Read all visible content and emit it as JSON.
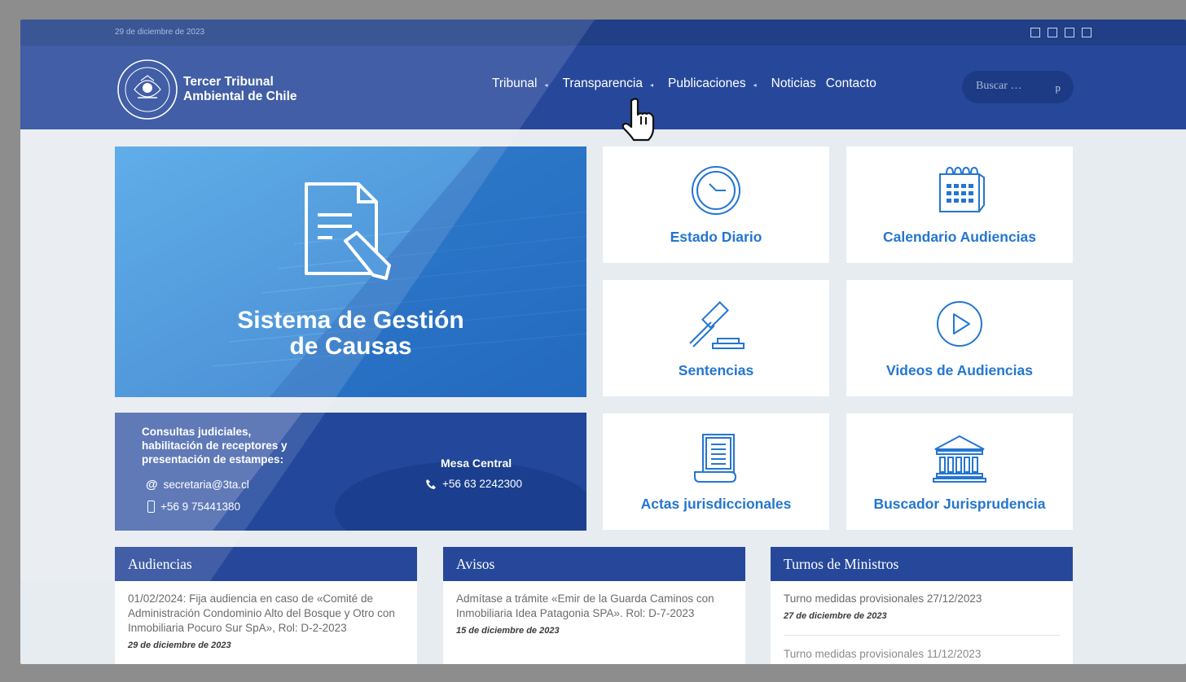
{
  "topbar": {
    "date": "29 de diciembre de 2023",
    "social_icons": [
      "social-icon",
      "social-icon",
      "social-icon",
      "social-icon"
    ]
  },
  "header": {
    "site_name_line1": "Tercer Tribunal",
    "site_name_line2": "Ambiental de Chile",
    "nav": [
      {
        "label": "Tribunal",
        "has_menu": true
      },
      {
        "label": "Transparencia",
        "has_menu": true
      },
      {
        "label": "Publicaciones",
        "has_menu": true
      },
      {
        "label": "Noticias",
        "has_menu": false
      },
      {
        "label": "Contacto",
        "has_menu": false
      }
    ],
    "caret_glyph": "◂",
    "search_placeholder": "Buscar …",
    "search_icon_glyph": "p"
  },
  "hero": {
    "title_line1": "Sistema de Gestión",
    "title_line2": "de Causas"
  },
  "contact": {
    "label_line1": "Consultas judiciales,",
    "label_line2": "habilitación de receptores y",
    "label_line3": "presentación de estampes:",
    "email": "secretaria@3ta.cl",
    "mobile": "+56 9 75441380",
    "mesa_central_label": "Mesa Central",
    "mesa_central_phone": "+56 63 2242300"
  },
  "tiles": {
    "estado_diario": "Estado Diario",
    "calendario": "Calendario Audiencias",
    "sentencias": "Sentencias",
    "videos": "Videos de Audiencias",
    "actas": "Actas jurisdiccionales",
    "buscador": "Buscador Jurisprudencia"
  },
  "columns": {
    "audiencias": {
      "title": "Audiencias",
      "post_text": "01/02/2024: Fija audiencia en caso de «Comité de Administración Condominio Alto del Bosque y Otro con Inmobiliaria Pocuro Sur SpA», Rol: D-2-2023",
      "post_date": "29 de diciembre de 2023"
    },
    "avisos": {
      "title": "Avisos",
      "post_text": "Admítase a trámite «Emir de la Guarda Caminos con Inmobiliaria Idea Patagonia SPA». Rol: D-7-2023",
      "post_date": "15 de diciembre de 2023"
    },
    "turnos": {
      "title": "Turnos de Ministros",
      "post_text": "Turno medidas provisionales 27/12/2023",
      "post_date": "27 de diciembre de 2023",
      "post2_text": "Turno medidas provisionales 11/12/2023"
    }
  },
  "colors": {
    "navy": "#203f87",
    "header_blue": "#27489a",
    "tile_text": "#2476d0",
    "page_bg": "#e7ecf1"
  }
}
